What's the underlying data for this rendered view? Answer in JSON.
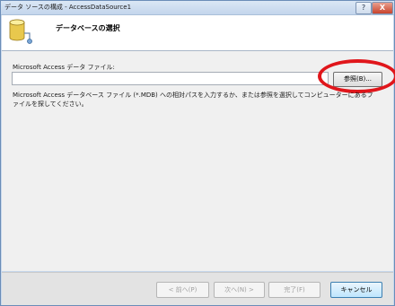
{
  "window": {
    "title": "データ ソースの構成 - AccessDataSource1"
  },
  "titlebar_buttons": {
    "help": "?",
    "close": "X"
  },
  "header": {
    "title": "データベースの選択",
    "icon": "database-icon"
  },
  "form": {
    "file_label": "Microsoft Access データ ファイル:",
    "file_value": "",
    "browse_label": "参照(B)...",
    "description": "Microsoft Access データベース ファイル (*.MDB) への相対パスを入力するか、または参照を選択してコンピューターにあるファイルを探してください。"
  },
  "buttons": {
    "prev": "< 前へ(P)",
    "next": "次へ(N) >",
    "finish": "完了(F)",
    "cancel": "キャンセル"
  },
  "colors": {
    "highlight": "#e0161b",
    "title_bar": "#c3d5ec"
  }
}
